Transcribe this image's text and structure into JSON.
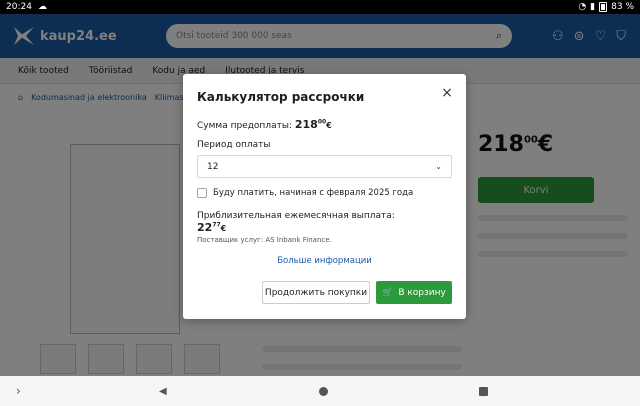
{
  "status_bar": {
    "time": "20:24",
    "battery": "83 %"
  },
  "header": {
    "logo_text": "kaup24.ee",
    "search_placeholder": "Otsi tooteid 300 000 seas"
  },
  "nav": {
    "items": [
      "Kõik tooted",
      "Tööriistad",
      "Kodu ja aed",
      "Ilutooted ja tervis"
    ]
  },
  "breadcrumbs": [
    "Kodumasinad ja elektroonika",
    "Kliimaseadmed"
  ],
  "product": {
    "price_main": "218",
    "price_cents": "00",
    "currency": "€",
    "buy_label": "Korvi"
  },
  "modal": {
    "title": "Калькулятор рассрочки",
    "prepay_label": "Сумма предоплаты:",
    "prepay_amount": "218",
    "prepay_cents": "00",
    "currency": "€",
    "period_label": "Период оплаты",
    "period_value": "12",
    "checkbox_label": "Буду платить, начиная с февраля 2025 года",
    "monthly_label": "Приблизительная ежемесячная выплата:",
    "monthly_amount": "22",
    "monthly_cents": "77",
    "provider": "Поставщик услуг: AS Inbank Finance.",
    "more_link": "Больше информации",
    "continue_label": "Продолжить покупки",
    "cart_label": "В корзину"
  },
  "icons": {
    "close": "close-icon",
    "chevron": "chevron-down-icon",
    "cart": "cart-icon"
  },
  "colors": {
    "brand_blue": "#1a5ba6",
    "green": "#2b9a3a"
  }
}
